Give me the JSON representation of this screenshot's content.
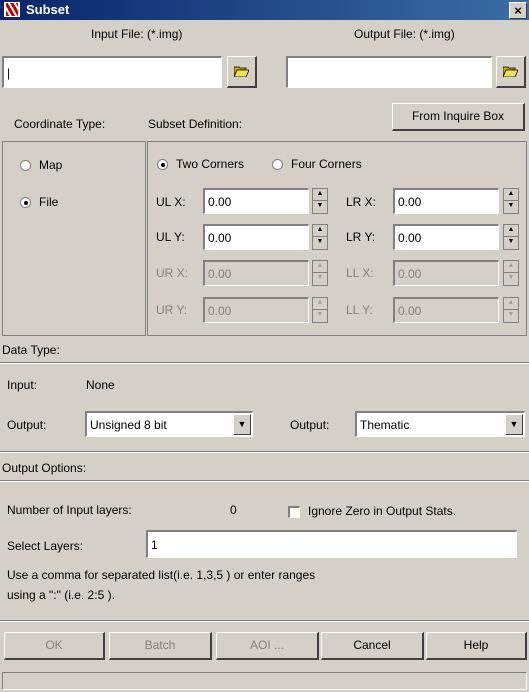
{
  "window": {
    "title": "Subset",
    "close": "×"
  },
  "files": {
    "input_label": "Input File: (*.img)",
    "output_label": "Output File: (*.img)",
    "input_value": "|",
    "output_value": ""
  },
  "coordinate": {
    "label": "Coordinate Type:",
    "options": [
      "Map",
      "File"
    ],
    "selected": "File"
  },
  "subset": {
    "label": "Subset Definition:",
    "inquire_button": "From Inquire Box",
    "mode_options": [
      "Two Corners",
      "Four Corners"
    ],
    "mode_selected": "Two Corners",
    "ulx": {
      "label": "UL X:",
      "value": "0.00"
    },
    "uly": {
      "label": "UL Y:",
      "value": "0.00"
    },
    "lrx": {
      "label": "LR X:",
      "value": "0.00"
    },
    "lry": {
      "label": "LR Y:",
      "value": "0.00"
    },
    "urx": {
      "label": "UR X:",
      "value": "0.00"
    },
    "ury": {
      "label": "UR Y:",
      "value": "0.00"
    },
    "llx": {
      "label": "LL X:",
      "value": "0.00"
    },
    "lly": {
      "label": "LL Y:",
      "value": "0.00"
    }
  },
  "data_type": {
    "label": "Data Type:",
    "input_label": "Input:",
    "input_value": "None",
    "output_label": "Output:",
    "output_value": "Unsigned 8 bit",
    "output2_label": "Output:",
    "output2_value": "Thematic"
  },
  "output_options": {
    "label": "Output Options:",
    "num_layers_label": "Number of Input layers:",
    "num_layers_value": "0",
    "ignore_zero_label": "Ignore Zero in Output Stats.",
    "select_layers_label": "Select Layers:",
    "select_layers_value": "1",
    "help_line1": "Use a comma for separated list(i.e. 1,3,5 ) or enter ranges",
    "help_line2": "using a \":\" (i.e. 2:5 )."
  },
  "buttons": {
    "ok": "OK",
    "batch": "Batch",
    "aoi": "AOI ...",
    "cancel": "Cancel",
    "help": "Help"
  },
  "colors": {
    "title_bar": "#0a246a",
    "face": "#d4d0c8",
    "folder": "#c8b400"
  }
}
